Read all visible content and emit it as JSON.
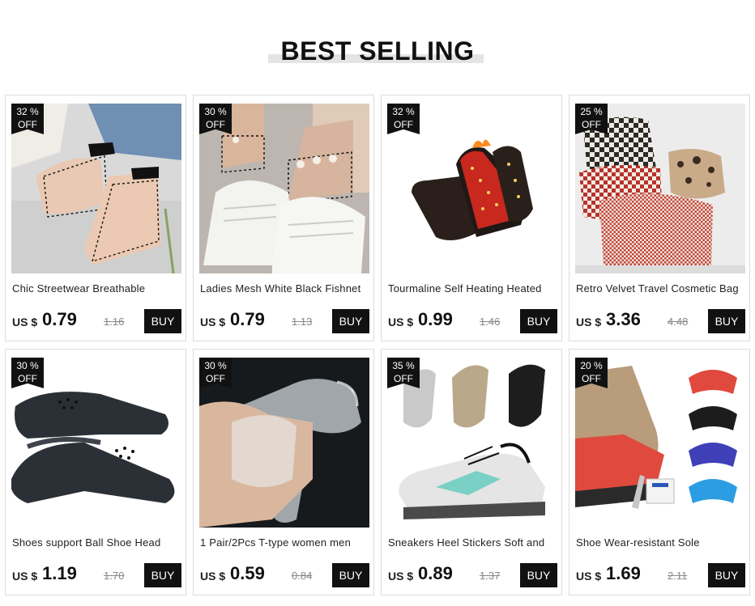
{
  "section": {
    "title": "BEST SELLING"
  },
  "products": [
    {
      "title": "Chic Streetwear Breathable",
      "currency": "US $",
      "price": "0.79",
      "old_price": "1.16",
      "discount": "32 %",
      "discount_suffix": "OFF",
      "buy": "BUY",
      "image": "fishnet-socks-photo"
    },
    {
      "title": "Ladies Mesh White Black Fishnet",
      "currency": "US $",
      "price": "0.79",
      "old_price": "1.13",
      "discount": "30 %",
      "discount_suffix": "OFF",
      "buy": "BUY",
      "image": "pearl-fishnet-socks-photo"
    },
    {
      "title": "Tourmaline Self Heating Heated",
      "currency": "US $",
      "price": "0.99",
      "old_price": "1.46",
      "discount": "32 %",
      "discount_suffix": "OFF",
      "buy": "BUY",
      "image": "heating-socks-photo"
    },
    {
      "title": "Retro Velvet Travel Cosmetic Bag",
      "currency": "US $",
      "price": "3.36",
      "old_price": "4.48",
      "discount": "25 %",
      "discount_suffix": "OFF",
      "buy": "BUY",
      "image": "cosmetic-bags-photo"
    },
    {
      "title": "Shoes support Ball Shoe Head",
      "currency": "US $",
      "price": "1.19",
      "old_price": "1.70",
      "discount": "30 %",
      "discount_suffix": "OFF",
      "buy": "BUY",
      "image": "shoe-crease-protector-photo"
    },
    {
      "title": "1 Pair/2Pcs T-type  women men",
      "currency": "US $",
      "price": "0.59",
      "old_price": "0.84",
      "discount": "30 %",
      "discount_suffix": "OFF",
      "buy": "BUY",
      "image": "gel-heel-pads-photo"
    },
    {
      "title": "Sneakers Heel Stickers Soft and",
      "currency": "US $",
      "price": "0.89",
      "old_price": "1.37",
      "discount": "35 %",
      "discount_suffix": "OFF",
      "buy": "BUY",
      "image": "heel-stickers-sneaker-photo"
    },
    {
      "title": "Shoe Wear-resistant Sole",
      "currency": "US $",
      "price": "1.69",
      "old_price": "2.11",
      "discount": "20 %",
      "discount_suffix": "OFF",
      "buy": "BUY",
      "image": "sole-protector-photo"
    }
  ],
  "colors": {
    "accent": "#111111",
    "heading_bar": "#e4e4e4",
    "old_price": "#888888"
  }
}
